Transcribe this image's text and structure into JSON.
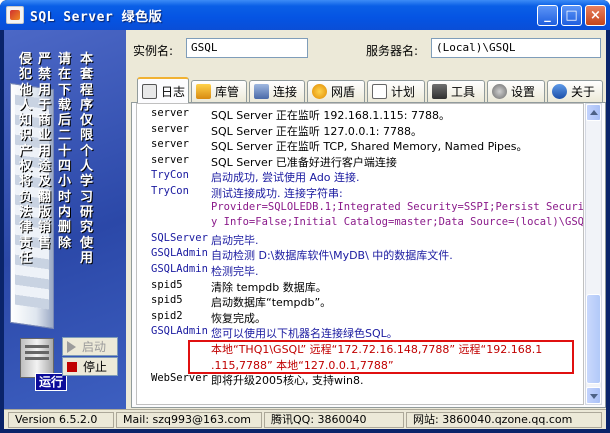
{
  "window": {
    "title": "SQL Server 绿色版",
    "minimize_glyph": "_",
    "maximize_glyph": "□",
    "close_glyph": "×"
  },
  "header": {
    "instance_label": "实例名:",
    "instance_value": "GSQL",
    "server_label": "服务器名:",
    "server_value": "(Local)\\GSQL"
  },
  "side": {
    "columns": [
      "本套程序仅限个人学习研究使用",
      "请在下载后二十四小时内删除",
      "严禁用于商业用途及翻版销售",
      "侵犯他人知识产权将负法律责任"
    ],
    "run_label": "运行",
    "start_button": "启动",
    "stop_button": "停止"
  },
  "tabs": [
    {
      "label": "日志",
      "icon": "log-icon"
    },
    {
      "label": "库管",
      "icon": "database-icon"
    },
    {
      "label": "连接",
      "icon": "connection-icon"
    },
    {
      "label": "网盾",
      "icon": "shield-icon"
    },
    {
      "label": "计划",
      "icon": "schedule-icon"
    },
    {
      "label": "工具",
      "icon": "tools-icon"
    },
    {
      "label": "设置",
      "icon": "settings-icon"
    },
    {
      "label": "关于",
      "icon": "about-icon"
    }
  ],
  "log": [
    {
      "src": "server",
      "msg": "SQL Server 正在监听 192.168.1.115: 7788。",
      "color": "#000000"
    },
    {
      "src": "server",
      "msg": "SQL Server 正在监听 127.0.0.1: 7788。",
      "color": "#000000"
    },
    {
      "src": "server",
      "msg": "SQL Server 正在监听 TCP, Shared Memory, Named Pipes。",
      "color": "#000000"
    },
    {
      "src": "server",
      "msg": "SQL Server 已准备好进行客户端连接",
      "color": "#000000"
    },
    {
      "src": "TryCon",
      "msg": "启动成功, 尝试使用 Ado 连接.",
      "color": "#1a1aa0"
    },
    {
      "src": "TryCon",
      "msg": "测试连接成功. 连接字符串:",
      "color": "#1a1aa0"
    },
    {
      "src": "",
      "msg": "Provider=SQLOLEDB.1;Integrated Security=SSPI;Persist Securit",
      "color": "#8a1a8a"
    },
    {
      "src": "",
      "msg": "y Info=False;Initial Catalog=master;Data Source=(local)\\GSQL",
      "color": "#8a1a8a"
    },
    {
      "src": "SQLServer",
      "msg": "启动完毕.",
      "color": "#1a1aa0"
    },
    {
      "src": "GSQLAdmin",
      "msg": "自动检测 D:\\数据库软件\\MyDB\\ 中的数据库文件.",
      "color": "#1a1aa0"
    },
    {
      "src": "GSQLAdmin",
      "msg": "检测完毕.",
      "color": "#1a1aa0"
    },
    {
      "src": "spid5",
      "msg": "清除 tempdb 数据库。",
      "color": "#000000"
    },
    {
      "src": "spid5",
      "msg": "启动数据库“tempdb”。",
      "color": "#000000"
    },
    {
      "src": "spid2",
      "msg": "恢复完成。",
      "color": "#000000"
    },
    {
      "src": "GSQLAdmin",
      "msg": "您可以使用以下机器名连接绿色SQL。",
      "color": "#1a1aa0"
    },
    {
      "src": "",
      "msg": "本地“THQ1\\GSQL” 远程“172.72.16.148,7788” 远程“192.168.1",
      "color": "#c00000"
    },
    {
      "src": "",
      "msg": ".115,7788” 本地“127.0.0.1,7788”",
      "color": "#c00000"
    },
    {
      "src": "WebServer",
      "msg": "即将升级2005核心, 支持win8.",
      "color": "#000000"
    }
  ],
  "status": {
    "version": "Version 6.5.2.0",
    "mail": "Mail: szq993@163.com",
    "qq": "腾讯QQ: 3860040",
    "site": "网站: 3860040.qzone.qq.com"
  }
}
